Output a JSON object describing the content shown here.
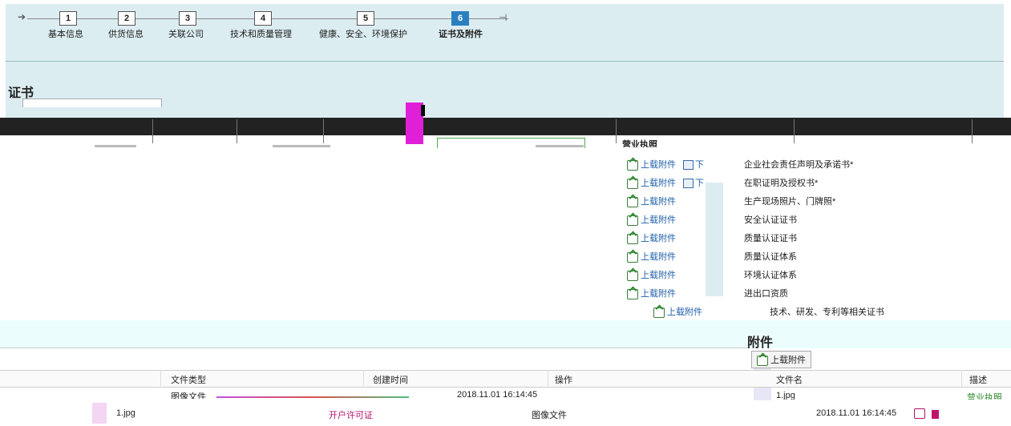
{
  "wizard": {
    "steps": [
      {
        "num": "1",
        "label": "基本信息"
      },
      {
        "num": "2",
        "label": "供货信息"
      },
      {
        "num": "3",
        "label": "关联公司"
      },
      {
        "num": "4",
        "label": "技术和质量管理"
      },
      {
        "num": "5",
        "label": "健康、安全、环境保护"
      },
      {
        "num": "6",
        "label": "证书及附件"
      }
    ],
    "active_step": 6
  },
  "certificates": {
    "title": "证书",
    "upload_label": "上载附件",
    "download_label": "下",
    "row_partial": "营业执照",
    "items": [
      {
        "upload": "上载附件",
        "name": "企业社会责任声明及承诺书*"
      },
      {
        "upload": "上载附件",
        "name": "在职证明及授权书*"
      },
      {
        "upload": "上载附件",
        "name": "生产现场照片、门牌照*"
      },
      {
        "upload": "上载附件",
        "name": "安全认证证书"
      },
      {
        "upload": "上载附件",
        "name": "质量认证证书"
      },
      {
        "upload": "上载附件",
        "name": "质量认证体系"
      },
      {
        "upload": "上载附件",
        "name": "环境认证体系"
      },
      {
        "upload": "上载附件",
        "name": "进出口资质"
      }
    ],
    "last_item": {
      "upload": "上载附件",
      "name": "技术、研发、专利等相关证书"
    }
  },
  "attachments_left": {
    "columns": {
      "file_type": "文件类型",
      "created": "创建时间",
      "ops": "操作"
    },
    "row": {
      "file_type_partial": "图像文件",
      "created": "2018.11.01 16:14:45"
    }
  },
  "attachments": {
    "title": "附件",
    "upload_button": "上载附件",
    "columns": {
      "file_name": "文件名",
      "desc": "描述"
    },
    "row": {
      "file_name": "1.jpg",
      "desc": "营业执照"
    }
  },
  "bottom_row": {
    "file": "1.jpg",
    "cert": "开户许可证",
    "type": "图像文件",
    "time": "2018.11.01 16:14:45"
  },
  "colors": {
    "panel": "#dcedf1",
    "accent": "#2a7fc0",
    "link": "#1f5fa8",
    "pink": "#c0146b"
  }
}
